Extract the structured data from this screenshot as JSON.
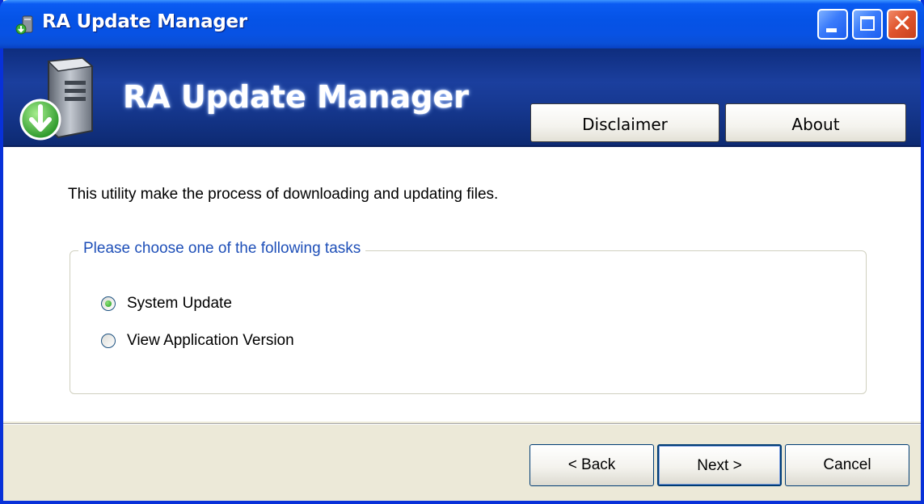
{
  "window": {
    "title": "RA Update Manager",
    "minimize_icon": "minimize-icon",
    "maximize_icon": "maximize-icon",
    "close_icon": "close-icon",
    "close_glyph": "✕"
  },
  "header": {
    "app_icon": "server-download-icon",
    "title": "RA Update Manager",
    "disclaimer_label": "Disclaimer",
    "about_label": "About"
  },
  "main": {
    "intro_text": "This utility make the process of downloading and updating files.",
    "group_title": "Please choose one of the following tasks",
    "options": [
      {
        "label": "System Update",
        "checked": true
      },
      {
        "label": "View Application Version",
        "checked": false
      }
    ]
  },
  "footer": {
    "back_label": "< Back",
    "next_label": "Next >",
    "cancel_label": "Cancel"
  },
  "colors": {
    "titlebar": "#0553e6",
    "banner": "#1b3f9e",
    "group_title": "#1e4fb8",
    "window_bg": "#ece9d8"
  }
}
